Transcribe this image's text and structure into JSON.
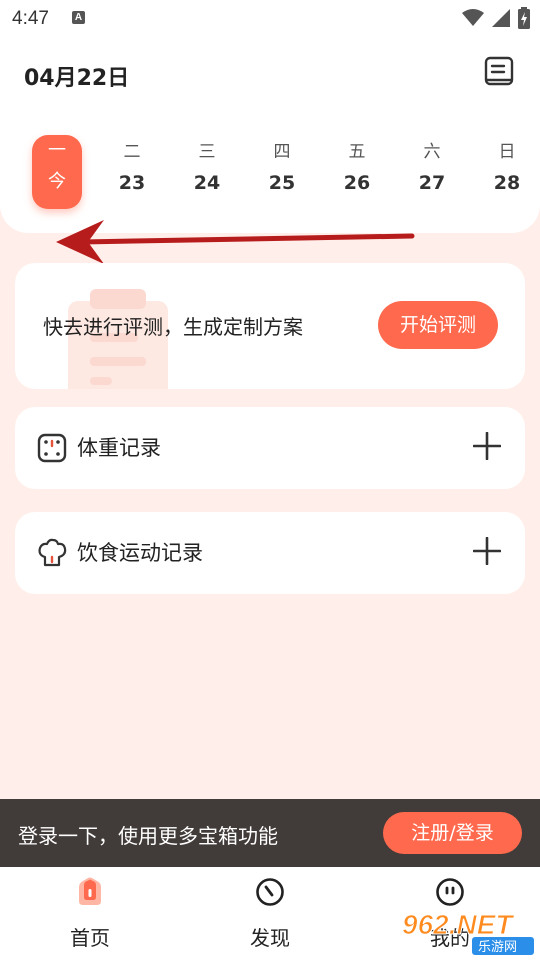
{
  "status_bar": {
    "time": "4:47",
    "notif_letter": "A"
  },
  "header": {
    "date": "04月22日",
    "week": [
      {
        "day": "一",
        "num": "今",
        "today": true
      },
      {
        "day": "二",
        "num": "23"
      },
      {
        "day": "三",
        "num": "24"
      },
      {
        "day": "四",
        "num": "25"
      },
      {
        "day": "五",
        "num": "26"
      },
      {
        "day": "六",
        "num": "27"
      },
      {
        "day": "日",
        "num": "28"
      }
    ]
  },
  "evaluation": {
    "text": "快去进行评测，生成定制方案",
    "button": "开始评测"
  },
  "records": [
    {
      "label": "体重记录",
      "icon": "scale-icon"
    },
    {
      "label": "饮食运动记录",
      "icon": "chef-hat-icon"
    }
  ],
  "login_banner": {
    "text": "登录一下，使用更多宝箱功能",
    "button": "注册/登录"
  },
  "tabs": [
    {
      "label": "首页",
      "icon": "home-icon"
    },
    {
      "label": "发现",
      "icon": "compass-icon"
    },
    {
      "label": "我的",
      "icon": "face-icon"
    }
  ],
  "watermark": {
    "brand": "962.NET",
    "sub": "乐游网"
  },
  "colors": {
    "accent": "#ff6a4e",
    "background": "#ffeee9",
    "banner": "#413b39",
    "arrow": "#b71c1c"
  }
}
